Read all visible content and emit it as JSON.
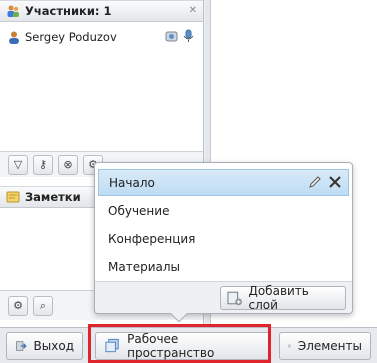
{
  "participants": {
    "title": "Участники: 1",
    "list": [
      {
        "name": "Sergey Poduzov"
      }
    ]
  },
  "notes": {
    "title": "Заметки"
  },
  "layers_popup": {
    "items": [
      {
        "label": "Начало",
        "selected": true
      },
      {
        "label": "Обучение",
        "selected": false
      },
      {
        "label": "Конференция",
        "selected": false
      },
      {
        "label": "Материалы",
        "selected": false
      }
    ],
    "add_layer_label": "Добавить слой"
  },
  "bottom_bar": {
    "exit_label": "Выход",
    "workspace_label": "Рабочее пространство",
    "elements_label": "Элементы"
  },
  "colors": {
    "highlight": "#e0242b",
    "selection": "#bfdcf3"
  }
}
